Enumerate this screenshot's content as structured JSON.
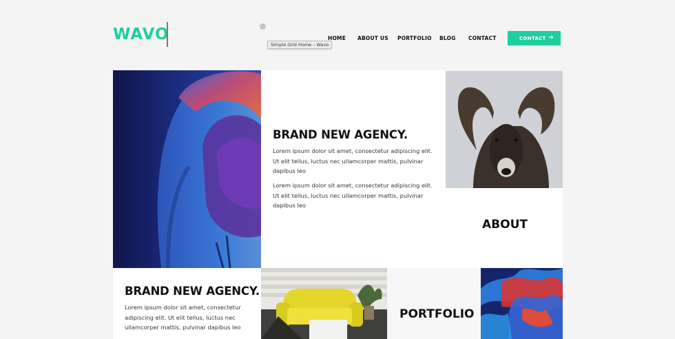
{
  "header": {
    "logo": "WAVO",
    "tooltip": "Simple Grid Home – Wavo",
    "nav": [
      {
        "label": "HOME"
      },
      {
        "label": "ABOUT US"
      },
      {
        "label": "PORTFOLIO"
      },
      {
        "label": "BLOG"
      },
      {
        "label": "CONTACT"
      }
    ],
    "cta_label": "CONTACT",
    "cta_icon": "arrow-right-icon"
  },
  "grid": {
    "hero_text": {
      "title": "BRAND NEW AGENCY.",
      "paragraphs": [
        "Lorem ipsum dolor sit amet, consectetur adipiscing elit. Ut elit tellus, luctus nec ullamcorper mattis, pulvinar dapibus leo",
        "Lorem ipsum dolor sit amet, consectetur adipiscing elit. Ut elit tellus, luctus nec ullamcorper mattis, pulvinar dapibus leo"
      ]
    },
    "about": {
      "title": "ABOUT"
    },
    "second_text": {
      "title": "BRAND NEW AGENCY.",
      "paragraph": "Lorem ipsum dolor sit amet, consectetur adipiscing elit. Ut elit tellus, luctus nec ullamcorper mattis, pulvinar dapibus leo"
    },
    "portfolio": {
      "title": "PORTFOLIO"
    }
  },
  "colors": {
    "accent": "#1fcf9f",
    "background": "#f4f4f4"
  }
}
